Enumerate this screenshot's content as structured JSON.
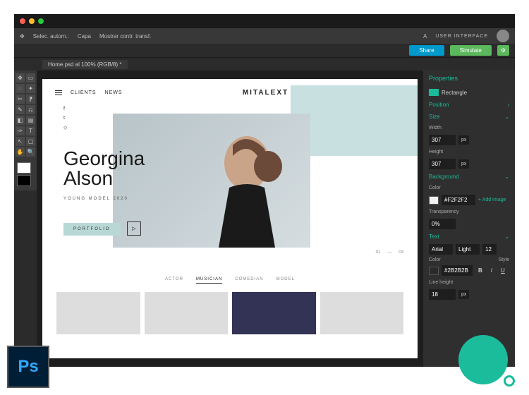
{
  "menubar": {
    "select": "Selec. autom.:",
    "layer": "Capa",
    "transform": "Mostrar contr. transf.",
    "ui_label": "USER INTERFACE"
  },
  "actions": {
    "share": "Share",
    "simulate": "Simulate"
  },
  "tab": {
    "title": "Home.psd al 100% (RGB/8) *"
  },
  "design": {
    "nav": {
      "clients": "CLIENTS",
      "news": "NEWS",
      "brand": "MITALEXT"
    },
    "hero": {
      "name_first": "Georgina",
      "name_last": "Alson",
      "subtitle": "YOUNG MODEL 2020",
      "portfolio": "PORTFOLIO",
      "page_current": "01",
      "page_total": "03"
    },
    "categories": [
      "ACTOR",
      "MUSICIAN",
      "COMEDIAN",
      "MODEL"
    ]
  },
  "props": {
    "title": "Properties",
    "shape": "Rectangle",
    "position": "Position",
    "size": "Size",
    "width_label": "Width",
    "width": "307",
    "height_label": "Height",
    "height": "307",
    "unit": "px",
    "background": "Background",
    "color_label": "Color",
    "bg_color": "#F2F2F2",
    "add_image": "+  Add Image",
    "transparency_label": "Transparency",
    "transparency": "0%",
    "text": "Text",
    "font": "Arial",
    "weight": "Light",
    "fontsize": "12",
    "text_color": "#2B2B2B",
    "style_label": "Style",
    "lineheight_label": "Line height",
    "lineheight": "18"
  },
  "badge": "Ps"
}
